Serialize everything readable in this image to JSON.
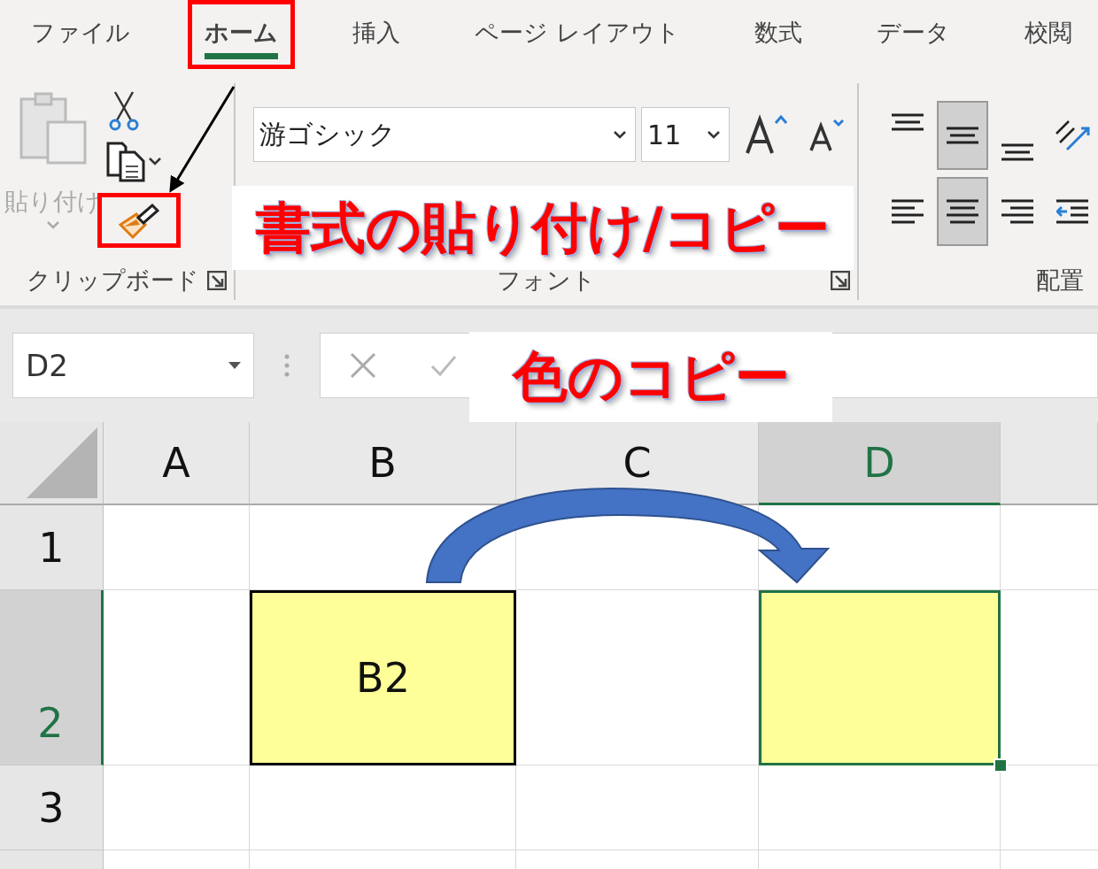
{
  "ribbon_tabs": [
    {
      "label": "ファイル",
      "selected": false,
      "highlighted": false
    },
    {
      "label": "ホーム",
      "selected": true,
      "highlighted": true
    },
    {
      "label": "挿入",
      "selected": false,
      "highlighted": false
    },
    {
      "label": "ページ レイアウト",
      "selected": false,
      "highlighted": false
    },
    {
      "label": "数式",
      "selected": false,
      "highlighted": false
    },
    {
      "label": "データ",
      "selected": false,
      "highlighted": false
    },
    {
      "label": "校閲",
      "selected": false,
      "highlighted": false
    }
  ],
  "clipboard_group": {
    "paste_label": "貼り付け",
    "paste_disabled": true,
    "format_painter_highlighted": true,
    "label": "クリップボード"
  },
  "font_group": {
    "font_name": "游ゴシック",
    "font_size": "11",
    "label": "フォント"
  },
  "alignment_group": {
    "label": "配置",
    "buttons": [
      {
        "kind": "top",
        "selected": false
      },
      {
        "kind": "middle",
        "selected": true
      },
      {
        "kind": "bottom",
        "selected": false
      },
      {
        "kind": "orientation",
        "selected": false
      },
      {
        "kind": "left",
        "selected": false
      },
      {
        "kind": "center",
        "selected": true
      },
      {
        "kind": "right",
        "selected": false
      },
      {
        "kind": "outdent",
        "selected": false
      }
    ]
  },
  "name_box": "D2",
  "columns": [
    {
      "label": "A",
      "selected": false
    },
    {
      "label": "B",
      "selected": false
    },
    {
      "label": "C",
      "selected": false
    },
    {
      "label": "D",
      "selected": true
    }
  ],
  "rows": [
    {
      "header": "1",
      "selected": false,
      "cells": [
        {
          "kind": "blank"
        },
        {
          "kind": "blank"
        },
        {
          "kind": "blank"
        },
        {
          "kind": "blank"
        }
      ]
    },
    {
      "header": "2",
      "selected": true,
      "cells": [
        {
          "kind": "blank"
        },
        {
          "kind": "filled",
          "text": "B2",
          "color": "#ffff99",
          "bordered": true,
          "active": false
        },
        {
          "kind": "blank"
        },
        {
          "kind": "filled",
          "color": "#ffff99",
          "bordered": false,
          "active": true
        }
      ]
    },
    {
      "header": "3",
      "selected": false,
      "cells": [
        {
          "kind": "blank"
        },
        {
          "kind": "blank"
        },
        {
          "kind": "blank"
        },
        {
          "kind": "blank"
        }
      ]
    }
  ],
  "callouts": [
    {
      "text": "書式の貼り付け/コピー"
    },
    {
      "text": "色のコピー"
    }
  ]
}
